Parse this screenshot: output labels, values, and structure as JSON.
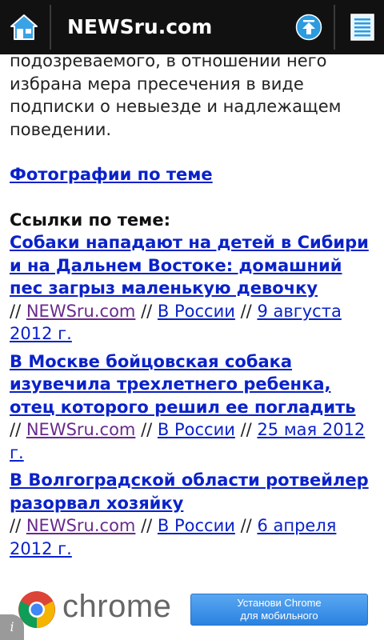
{
  "topbar": {
    "title": "NEWSru.com",
    "home_icon": "home-icon",
    "up_icon": "scroll-up-icon",
    "menu_icon": "list-icon"
  },
  "article": {
    "intro_text": "подозреваемого, в отношении него избрана мера пресечения в виде подписки о невыезде и надлежащем поведении.",
    "photos_link": "Фотографии по теме",
    "links_heading": "Ссылки по теме:",
    "related": [
      {
        "title": "Собаки нападают на детей в Сибири и на Дальнем Востоке: домашний пес загрыз маленькую девочку",
        "source": "NEWSru.com",
        "section": "В России",
        "date": "9 августа 2012 г."
      },
      {
        "title": "В Москве бойцовская собака изувечила трехлетнего ребенка, отец которого решил ее погладить",
        "source": "NEWSru.com",
        "section": "В России",
        "date": "25 мая 2012 г."
      },
      {
        "title": "В Волгоградской области ротвейлер разорвал хозяйку",
        "source": "NEWSru.com",
        "section": "В России",
        "date": "6 апреля 2012 г."
      }
    ],
    "separator": "//"
  },
  "ad": {
    "brand": "chrome",
    "button_line1": "Установи Chrome",
    "button_line2": "для мобильного",
    "info_glyph": "i"
  },
  "colors": {
    "link": "#0a22c9",
    "visited_link": "#6a2a8c",
    "topbar": "#111111",
    "ad_button": "#3a8fe8"
  }
}
